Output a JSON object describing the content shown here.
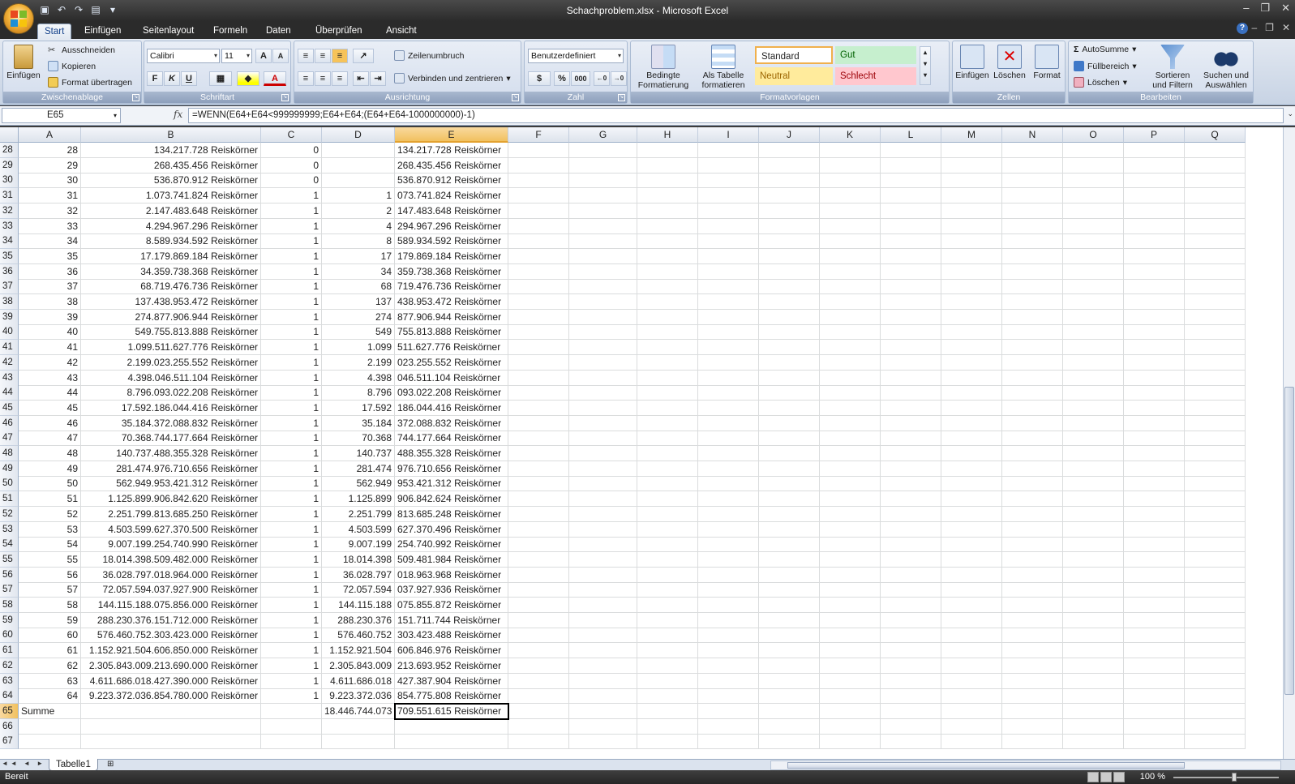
{
  "window": {
    "title": "Schachproblem.xlsx - Microsoft Excel"
  },
  "tabs": [
    "Start",
    "Einfügen",
    "Seitenlayout",
    "Formeln",
    "Daten",
    "Überprüfen",
    "Ansicht"
  ],
  "clipboard": {
    "paste": "Einfügen",
    "cut": "Ausschneiden",
    "copy": "Kopieren",
    "format": "Format übertragen",
    "label": "Zwischenablage"
  },
  "font": {
    "name": "Calibri",
    "size": "11",
    "bold": "F",
    "italic": "K",
    "underline": "U",
    "label": "Schriftart"
  },
  "alignment": {
    "wrap": "Zeilenumbruch",
    "merge": "Verbinden und zentrieren",
    "label": "Ausrichtung"
  },
  "number": {
    "format": "Benutzerdefiniert",
    "percent": "%",
    "thousand": "000",
    "label": "Zahl"
  },
  "styles": {
    "cond": "Bedingte",
    "cond2": "Formatierung",
    "table": "Als Tabelle",
    "table2": "formatieren",
    "standard": "Standard",
    "gut": "Gut",
    "neutral": "Neutral",
    "schlecht": "Schlecht",
    "label": "Formatvorlagen"
  },
  "cells_group": {
    "insert": "Einfügen",
    "delete": "Löschen",
    "format": "Format",
    "label": "Zellen"
  },
  "editing": {
    "autosum": "AutoSumme",
    "fill": "Füllbereich",
    "clear": "Löschen",
    "sort": "Sortieren",
    "sort2": "und Filtern",
    "find": "Suchen und",
    "find2": "Auswählen",
    "label": "Bearbeiten"
  },
  "formula_bar": {
    "name": "E65",
    "formula": "=WENN(E64+E64<999999999;E64+E64;(E64+E64-1000000000)-1)"
  },
  "columns": [
    "A",
    "B",
    "C",
    "D",
    "E",
    "F",
    "G",
    "H",
    "I",
    "J",
    "K",
    "L",
    "M",
    "N",
    "O",
    "P",
    "Q"
  ],
  "rows": [
    {
      "n": "28",
      "a": "28",
      "b": "134.217.728 Reiskörner",
      "c": "0",
      "d": "",
      "e": "134.217.728 Reiskörner"
    },
    {
      "n": "29",
      "a": "29",
      "b": "268.435.456 Reiskörner",
      "c": "0",
      "d": "",
      "e": "268.435.456 Reiskörner"
    },
    {
      "n": "30",
      "a": "30",
      "b": "536.870.912 Reiskörner",
      "c": "0",
      "d": "",
      "e": "536.870.912 Reiskörner"
    },
    {
      "n": "31",
      "a": "31",
      "b": "1.073.741.824 Reiskörner",
      "c": "1",
      "d": "1",
      "e": "073.741.824 Reiskörner"
    },
    {
      "n": "32",
      "a": "32",
      "b": "2.147.483.648 Reiskörner",
      "c": "1",
      "d": "2",
      "e": "147.483.648 Reiskörner"
    },
    {
      "n": "33",
      "a": "33",
      "b": "4.294.967.296 Reiskörner",
      "c": "1",
      "d": "4",
      "e": "294.967.296 Reiskörner"
    },
    {
      "n": "34",
      "a": "34",
      "b": "8.589.934.592 Reiskörner",
      "c": "1",
      "d": "8",
      "e": "589.934.592 Reiskörner"
    },
    {
      "n": "35",
      "a": "35",
      "b": "17.179.869.184 Reiskörner",
      "c": "1",
      "d": "17",
      "e": "179.869.184 Reiskörner"
    },
    {
      "n": "36",
      "a": "36",
      "b": "34.359.738.368 Reiskörner",
      "c": "1",
      "d": "34",
      "e": "359.738.368 Reiskörner"
    },
    {
      "n": "37",
      "a": "37",
      "b": "68.719.476.736 Reiskörner",
      "c": "1",
      "d": "68",
      "e": "719.476.736 Reiskörner"
    },
    {
      "n": "38",
      "a": "38",
      "b": "137.438.953.472 Reiskörner",
      "c": "1",
      "d": "137",
      "e": "438.953.472 Reiskörner"
    },
    {
      "n": "39",
      "a": "39",
      "b": "274.877.906.944 Reiskörner",
      "c": "1",
      "d": "274",
      "e": "877.906.944 Reiskörner"
    },
    {
      "n": "40",
      "a": "40",
      "b": "549.755.813.888 Reiskörner",
      "c": "1",
      "d": "549",
      "e": "755.813.888 Reiskörner"
    },
    {
      "n": "41",
      "a": "41",
      "b": "1.099.511.627.776 Reiskörner",
      "c": "1",
      "d": "1.099",
      "e": "511.627.776 Reiskörner"
    },
    {
      "n": "42",
      "a": "42",
      "b": "2.199.023.255.552 Reiskörner",
      "c": "1",
      "d": "2.199",
      "e": "023.255.552 Reiskörner"
    },
    {
      "n": "43",
      "a": "43",
      "b": "4.398.046.511.104 Reiskörner",
      "c": "1",
      "d": "4.398",
      "e": "046.511.104 Reiskörner"
    },
    {
      "n": "44",
      "a": "44",
      "b": "8.796.093.022.208 Reiskörner",
      "c": "1",
      "d": "8.796",
      "e": "093.022.208 Reiskörner"
    },
    {
      "n": "45",
      "a": "45",
      "b": "17.592.186.044.416 Reiskörner",
      "c": "1",
      "d": "17.592",
      "e": "186.044.416 Reiskörner"
    },
    {
      "n": "46",
      "a": "46",
      "b": "35.184.372.088.832 Reiskörner",
      "c": "1",
      "d": "35.184",
      "e": "372.088.832 Reiskörner"
    },
    {
      "n": "47",
      "a": "47",
      "b": "70.368.744.177.664 Reiskörner",
      "c": "1",
      "d": "70.368",
      "e": "744.177.664 Reiskörner"
    },
    {
      "n": "48",
      "a": "48",
      "b": "140.737.488.355.328 Reiskörner",
      "c": "1",
      "d": "140.737",
      "e": "488.355.328 Reiskörner"
    },
    {
      "n": "49",
      "a": "49",
      "b": "281.474.976.710.656 Reiskörner",
      "c": "1",
      "d": "281.474",
      "e": "976.710.656 Reiskörner"
    },
    {
      "n": "50",
      "a": "50",
      "b": "562.949.953.421.312 Reiskörner",
      "c": "1",
      "d": "562.949",
      "e": "953.421.312 Reiskörner"
    },
    {
      "n": "51",
      "a": "51",
      "b": "1.125.899.906.842.620 Reiskörner",
      "c": "1",
      "d": "1.125.899",
      "e": "906.842.624 Reiskörner"
    },
    {
      "n": "52",
      "a": "52",
      "b": "2.251.799.813.685.250 Reiskörner",
      "c": "1",
      "d": "2.251.799",
      "e": "813.685.248 Reiskörner"
    },
    {
      "n": "53",
      "a": "53",
      "b": "4.503.599.627.370.500 Reiskörner",
      "c": "1",
      "d": "4.503.599",
      "e": "627.370.496 Reiskörner"
    },
    {
      "n": "54",
      "a": "54",
      "b": "9.007.199.254.740.990 Reiskörner",
      "c": "1",
      "d": "9.007.199",
      "e": "254.740.992 Reiskörner"
    },
    {
      "n": "55",
      "a": "55",
      "b": "18.014.398.509.482.000 Reiskörner",
      "c": "1",
      "d": "18.014.398",
      "e": "509.481.984 Reiskörner"
    },
    {
      "n": "56",
      "a": "56",
      "b": "36.028.797.018.964.000 Reiskörner",
      "c": "1",
      "d": "36.028.797",
      "e": "018.963.968 Reiskörner"
    },
    {
      "n": "57",
      "a": "57",
      "b": "72.057.594.037.927.900 Reiskörner",
      "c": "1",
      "d": "72.057.594",
      "e": "037.927.936 Reiskörner"
    },
    {
      "n": "58",
      "a": "58",
      "b": "144.115.188.075.856.000 Reiskörner",
      "c": "1",
      "d": "144.115.188",
      "e": "075.855.872 Reiskörner"
    },
    {
      "n": "59",
      "a": "59",
      "b": "288.230.376.151.712.000 Reiskörner",
      "c": "1",
      "d": "288.230.376",
      "e": "151.711.744 Reiskörner"
    },
    {
      "n": "60",
      "a": "60",
      "b": "576.460.752.303.423.000 Reiskörner",
      "c": "1",
      "d": "576.460.752",
      "e": "303.423.488 Reiskörner"
    },
    {
      "n": "61",
      "a": "61",
      "b": "1.152.921.504.606.850.000 Reiskörner",
      "c": "1",
      "d": "1.152.921.504",
      "e": "606.846.976 Reiskörner"
    },
    {
      "n": "62",
      "a": "62",
      "b": "2.305.843.009.213.690.000 Reiskörner",
      "c": "1",
      "d": "2.305.843.009",
      "e": "213.693.952 Reiskörner"
    },
    {
      "n": "63",
      "a": "63",
      "b": "4.611.686.018.427.390.000 Reiskörner",
      "c": "1",
      "d": "4.611.686.018",
      "e": "427.387.904 Reiskörner"
    },
    {
      "n": "64",
      "a": "64",
      "b": "9.223.372.036.854.780.000 Reiskörner",
      "c": "1",
      "d": "9.223.372.036",
      "e": "854.775.808 Reiskörner"
    },
    {
      "n": "65",
      "a": "Summe",
      "b": "",
      "c": "",
      "d": "18.446.744.073",
      "e": "709.551.615 Reiskörner"
    },
    {
      "n": "66",
      "a": "",
      "b": "",
      "c": "",
      "d": "",
      "e": ""
    },
    {
      "n": "67",
      "a": "",
      "b": "",
      "c": "",
      "d": "",
      "e": ""
    }
  ],
  "sheet_tab": "Tabelle1",
  "status": {
    "ready": "Bereit",
    "zoom": "100 %"
  }
}
